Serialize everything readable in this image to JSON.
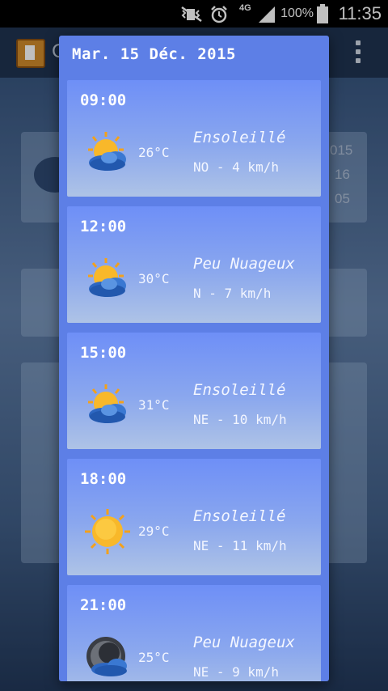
{
  "status_bar": {
    "network": "4G",
    "battery": "100%",
    "time": "11:35"
  },
  "app_bar": {
    "title_fragment": "C"
  },
  "background_cards": {
    "peek_lines": [
      "015",
      "16",
      "05"
    ]
  },
  "forecast_dialog": {
    "date": "Mar. 15 Déc. 2015",
    "entries": [
      {
        "time": "09:00",
        "temp": "26°C",
        "condition": "Ensoleillé",
        "wind": "NO - 4 km/h",
        "icon": "sun-behind-cloud-icon"
      },
      {
        "time": "12:00",
        "temp": "30°C",
        "condition": "Peu Nuageux",
        "wind": "N - 7 km/h",
        "icon": "sun-behind-cloud-icon"
      },
      {
        "time": "15:00",
        "temp": "31°C",
        "condition": "Ensoleillé",
        "wind": "NE - 10 km/h",
        "icon": "sun-behind-cloud-icon"
      },
      {
        "time": "18:00",
        "temp": "29°C",
        "condition": "Ensoleillé",
        "wind": "NE - 11 km/h",
        "icon": "sun-icon"
      },
      {
        "time": "21:00",
        "temp": "25°C",
        "condition": "Peu Nuageux",
        "wind": "NE - 9 km/h",
        "icon": "night-cloud-icon"
      }
    ]
  }
}
